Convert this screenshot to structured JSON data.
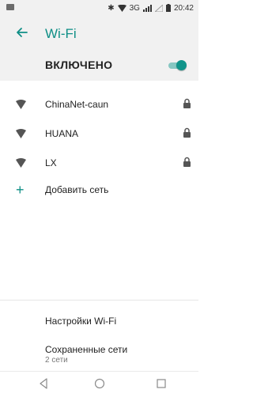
{
  "status_bar": {
    "network": "3G",
    "time": "20:42",
    "icons": [
      "notification-icon",
      "bluetooth-icon",
      "wifi-status-icon",
      "signal-icon",
      "battery-icon"
    ]
  },
  "header": {
    "title": "Wi-Fi",
    "back_icon": "arrow-left-icon"
  },
  "master_switch": {
    "label": "ВКЛЮЧЕНО",
    "on": true,
    "accent": "#10948a"
  },
  "networks": [
    {
      "name": "ChinaNet-caun",
      "secured": true
    },
    {
      "name": "HUANA",
      "secured": true
    },
    {
      "name": "LX",
      "secured": true
    }
  ],
  "add_network": {
    "label": "Добавить сеть"
  },
  "settings": {
    "label": "Настройки Wi-Fi"
  },
  "saved_networks": {
    "label": "Сохраненные сети",
    "sublabel": "2 сети"
  },
  "nav": {
    "icons": [
      "back-icon",
      "home-icon",
      "recents-icon"
    ]
  },
  "colors": {
    "accent": "#0f8f86",
    "background_header": "#f1f1f1"
  }
}
